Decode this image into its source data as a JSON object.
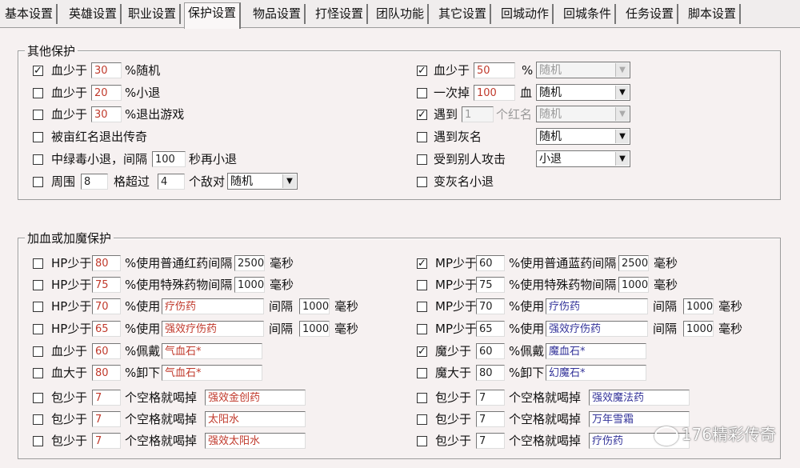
{
  "tabs": [
    "基本设置",
    "英雄设置",
    "职业设置",
    "保护设置",
    "物品设置",
    "打怪设置",
    "团队功能",
    "其它设置",
    "回城动作",
    "回城条件",
    "任务设置",
    "脚本设置"
  ],
  "active_tab": "保护设置",
  "other_protect": {
    "title": "其他保护",
    "left": {
      "r1": {
        "checked": true,
        "label": "血少于",
        "value": "30",
        "suffix": "%随机"
      },
      "r2": {
        "checked": false,
        "label": "血少于",
        "value": "20",
        "suffix": "%小退"
      },
      "r3": {
        "checked": false,
        "label": "血少于",
        "value": "30",
        "suffix": "%退出游戏"
      },
      "r4": {
        "checked": false,
        "label": "被亩红名退出传奇"
      },
      "r5": {
        "checked": false,
        "label": "中绿毒小退，间隔",
        "value": "100",
        "suffix": "秒再小退"
      },
      "r6": {
        "checked": false,
        "label": "周围",
        "value1": "8",
        "mid": "格超过",
        "value2": "4",
        "suffix": "个敌对",
        "select": "随机"
      }
    },
    "right": {
      "r1": {
        "checked": true,
        "label": "血少于",
        "value": "50",
        "suffix": "%",
        "select": "随机"
      },
      "r2": {
        "checked": false,
        "label": "一次掉",
        "value": "100",
        "suffix": "血",
        "select": "随机"
      },
      "r3": {
        "checked": true,
        "label": "遇到",
        "value": "1",
        "suffix": "个红名",
        "select": "随机"
      },
      "r4": {
        "checked": false,
        "label": "遇到灰名",
        "select": "随机"
      },
      "r5": {
        "checked": false,
        "label": "受到别人攻击",
        "select": "小退"
      },
      "r6": {
        "checked": false,
        "label": "变灰名小退"
      }
    }
  },
  "hp_mp_protect": {
    "title": "加血或加魔保护",
    "left": [
      {
        "checked": false,
        "label": "HP少于",
        "value": "80",
        "mid": "%使用普通红药间隔",
        "value2": "2500",
        "suffix": "毫秒"
      },
      {
        "checked": false,
        "label": "HP少于",
        "value": "75",
        "mid": "%使用特殊药物间隔",
        "value2": "1000",
        "suffix": "毫秒"
      },
      {
        "checked": false,
        "label": "HP少于",
        "value": "70",
        "mid": "%使用",
        "item": "疗伤药",
        "interval_label": "间隔",
        "value2": "1000",
        "suffix": "毫秒"
      },
      {
        "checked": false,
        "label": "HP少于",
        "value": "65",
        "mid": "%使用",
        "item": "强效疗伤药",
        "interval_label": "间隔",
        "value2": "1000",
        "suffix": "毫秒"
      },
      {
        "checked": false,
        "label": "血少于",
        "value": "60",
        "mid": "%佩戴",
        "item": "气血石*"
      },
      {
        "checked": false,
        "label": "血大于",
        "value": "80",
        "mid": "%卸下",
        "item": "气血石*"
      },
      {
        "checked": false,
        "label": "包少于",
        "value": "7",
        "mid": "个空格就喝掉",
        "item": "强效金创药"
      },
      {
        "checked": false,
        "label": "包少于",
        "value": "7",
        "mid": "个空格就喝掉",
        "item": "太阳水"
      },
      {
        "checked": false,
        "label": "包少于",
        "value": "7",
        "mid": "个空格就喝掉",
        "item": "强效太阳水"
      }
    ],
    "right": [
      {
        "checked": true,
        "label": "MP少于",
        "value": "60",
        "mid": "%使用普通蓝药间隔",
        "value2": "2500",
        "suffix": "毫秒"
      },
      {
        "checked": false,
        "label": "MP少于",
        "value": "75",
        "mid": "%使用特殊药物间隔",
        "value2": "1000",
        "suffix": "毫秒"
      },
      {
        "checked": false,
        "label": "MP少于",
        "value": "70",
        "mid": "%使用",
        "item": "疗伤药",
        "interval_label": "间隔",
        "value2": "1000",
        "suffix": "毫秒"
      },
      {
        "checked": false,
        "label": "MP少于",
        "value": "65",
        "mid": "%使用",
        "item": "强效疗伤药",
        "interval_label": "间隔",
        "value2": "1000",
        "suffix": "毫秒"
      },
      {
        "checked": true,
        "label": "魔少于",
        "value": "60",
        "mid": "%佩戴",
        "item": "魔血石*"
      },
      {
        "checked": false,
        "label": "魔大于",
        "value": "80",
        "mid": "%卸下",
        "item": "幻魔石*"
      },
      {
        "checked": false,
        "label": "包少于",
        "value": "7",
        "mid": "个空格就喝掉",
        "item": "强效魔法药"
      },
      {
        "checked": false,
        "label": "包少于",
        "value": "7",
        "mid": "个空格就喝掉",
        "item": "万年雪霜"
      },
      {
        "checked": false,
        "label": "包少于",
        "value": "7",
        "mid": "个空格就喝掉",
        "item": "疗伤药"
      }
    ]
  },
  "watermark": "176精彩传奇",
  "check_mark": "✓",
  "dropdown_arrow": "▼"
}
